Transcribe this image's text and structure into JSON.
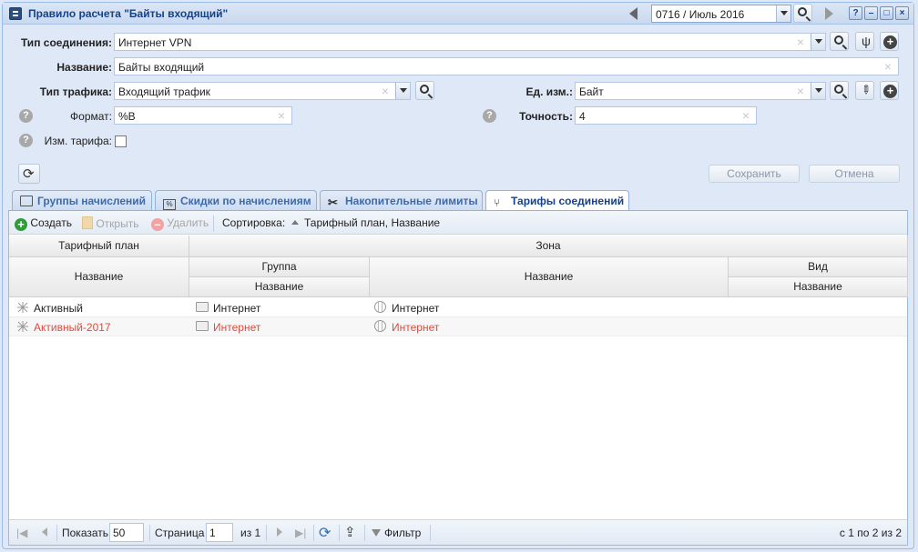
{
  "window": {
    "title": "Правило расчета \"Байты входящий\"",
    "period": "0716 / Июль 2016",
    "help_label": "?",
    "minimize_label": "–",
    "maximize_label": "□",
    "close_label": "×"
  },
  "form": {
    "connection_type": {
      "label": "Тип соединения:",
      "value": "Интернет VPN"
    },
    "name": {
      "label": "Название:",
      "value": "Байты входящий"
    },
    "traffic_type": {
      "label": "Тип трафика:",
      "value": "Входящий трафик"
    },
    "unit": {
      "label": "Ед. изм.:",
      "value": "Байт"
    },
    "format": {
      "label": "Формат:",
      "value": "%B"
    },
    "precision": {
      "label": "Точность:",
      "value": "4"
    },
    "tariff_change": {
      "label": "Изм. тарифа:",
      "checked": false
    },
    "save_button": "Сохранить",
    "cancel_button": "Отмена"
  },
  "tabs": [
    {
      "label": "Группы начислений",
      "icon": "groups-icon",
      "active": false
    },
    {
      "label": "Скидки по начислениям",
      "icon": "discount-icon",
      "active": false
    },
    {
      "label": "Накопительные лимиты",
      "icon": "scissors-icon",
      "active": false
    },
    {
      "label": "Тарифы соединений",
      "icon": "tariff-icon",
      "active": true
    }
  ],
  "toolbar": {
    "create": "Создать",
    "open": "Открыть",
    "delete": "Удалить",
    "sort_label": "Сортировка:",
    "sort_value": "Тарифный план, Название"
  },
  "grid": {
    "headers": {
      "tariff_plan": "Тарифный план",
      "zone": "Зона",
      "name": "Название",
      "group": "Группа",
      "group_name": "Название",
      "zone_name": "Название",
      "kind": "Вид",
      "kind_name": "Название"
    },
    "rows": [
      {
        "plan": "Активный",
        "group": "Интернет",
        "zone": "Интернет",
        "highlight": false
      },
      {
        "plan": "Активный-2017",
        "group": "Интернет",
        "zone": "Интернет",
        "highlight": true
      }
    ]
  },
  "pager": {
    "show_label": "Показать",
    "page_size": "50",
    "page_label": "Страница",
    "page": "1",
    "of_pages": "из 1",
    "filter": "Фильтр",
    "summary": "с 1 по 2 из 2"
  },
  "colors": {
    "accent": "#15428b",
    "highlight_row": "#e04b3f",
    "create_icon": "#2e9c3a"
  }
}
